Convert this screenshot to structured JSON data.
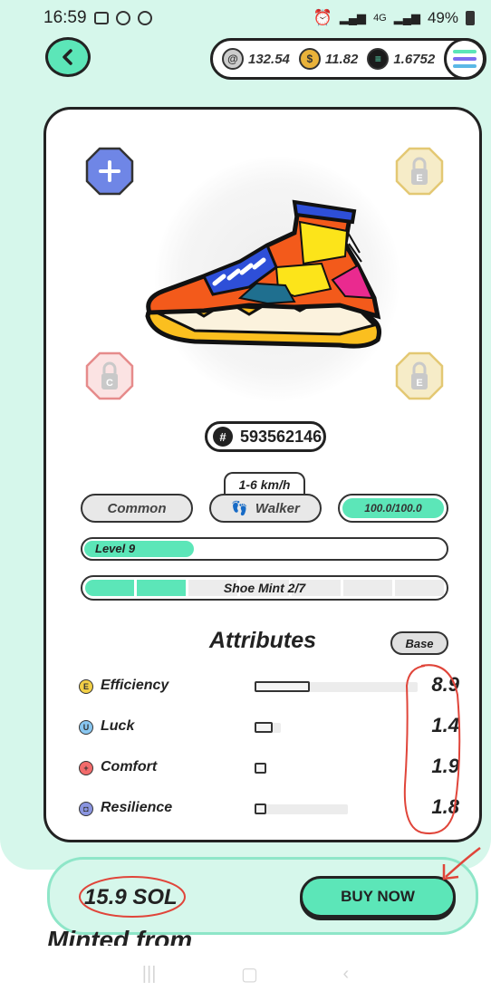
{
  "status_bar": {
    "time": "16:59",
    "battery": "49%",
    "signal": "4G"
  },
  "balances": {
    "gst": "132.54",
    "gmt": "11.82",
    "sol": "1.6752"
  },
  "sneaker": {
    "id": "593562146",
    "speed": "1-6 km/h",
    "quality": "Common",
    "type": "Walker",
    "durability": "100.0/100.0",
    "level": "Level 9",
    "level_progress": 0.3,
    "mint_label": "Shoe Mint 2/7",
    "mint_count": 2,
    "mint_total": 7
  },
  "attributes": {
    "title": "Attributes",
    "mode_button": "Base",
    "items": [
      {
        "name": "Efficiency",
        "value": "8.9",
        "icon": "E",
        "color": "#f2cf46",
        "fill": 0.34,
        "track": 1.0
      },
      {
        "name": "Luck",
        "value": "1.4",
        "icon": "U",
        "color": "#88c6f0",
        "fill": 0.11,
        "track": 0.16
      },
      {
        "name": "Comfort",
        "value": "1.9",
        "icon": "+",
        "color": "#f26b6b",
        "fill": 0.07,
        "track": 0.07
      },
      {
        "name": "Resilience",
        "value": "1.8",
        "icon": "◘",
        "color": "#8a95e0",
        "fill": 0.07,
        "track": 0.57
      }
    ]
  },
  "slots": {
    "add": "+",
    "locked_letters": [
      "E",
      "C",
      "E"
    ]
  },
  "purchase": {
    "price": "15.9 SOL",
    "buy_label": "BUY NOW"
  },
  "peek_text": "Minted from",
  "annotation_color": "#e0453a"
}
